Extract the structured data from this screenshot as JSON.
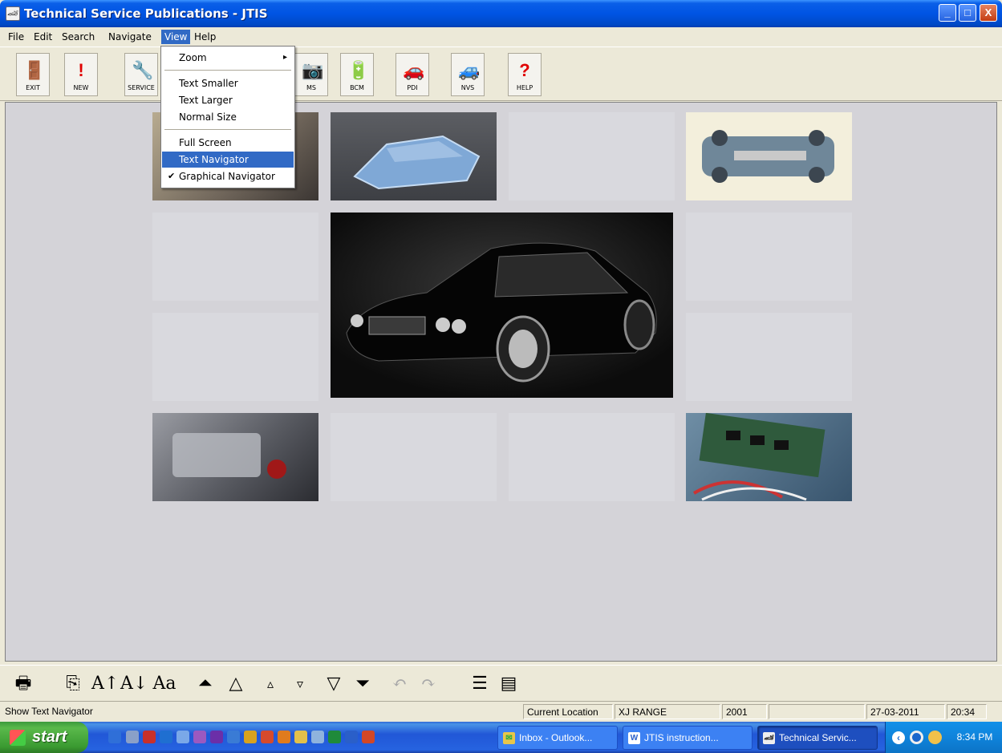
{
  "window": {
    "title": "Technical Service Publications - JTIS",
    "app_icon_glyph": "🏎",
    "minimize": "_",
    "maximize": "□",
    "close": "X"
  },
  "menu": {
    "items": [
      "File",
      "Edit",
      "Search",
      "Navigate",
      "View",
      "Help"
    ],
    "open_menu": "View"
  },
  "view_menu": {
    "items": [
      {
        "label": "Zoom",
        "submenu_arrow": "▸"
      },
      {
        "label": "Text Smaller"
      },
      {
        "label": "Text Larger"
      },
      {
        "label": "Normal Size"
      },
      {
        "label": "Full Screen"
      },
      {
        "label": "Text Navigator",
        "highlighted": true
      },
      {
        "label": "Graphical Navigator",
        "checked": true,
        "check": "✔"
      }
    ]
  },
  "toolbar": {
    "buttons": [
      {
        "label": "EXIT",
        "icon": "exit-door-icon",
        "glyph": "🚪"
      },
      {
        "label": "NEW",
        "icon": "exclamation-icon",
        "glyph": "!"
      },
      {
        "label": "SERVICE",
        "icon": "wrench-icon",
        "glyph": "🔧"
      },
      {
        "label": "MS",
        "icon": "camera-icon",
        "glyph": "📷"
      },
      {
        "label": "BCM",
        "icon": "battery-icon",
        "glyph": "🔋"
      },
      {
        "label": "PDI",
        "icon": "car-inspection-icon",
        "glyph": "🚗"
      },
      {
        "label": "NVS",
        "icon": "car-noise-icon",
        "glyph": "🚙"
      },
      {
        "label": "HELP",
        "icon": "question-icon",
        "glyph": "?"
      }
    ]
  },
  "navigator": {
    "images": [
      {
        "name": "car-front-image",
        "subject": "Jaguar front view",
        "color": "#8a7d6a"
      },
      {
        "name": "body-shell-image",
        "subject": "Body shell",
        "color": "#6f8fb0"
      },
      {
        "name": "chassis-image",
        "subject": "Chassis underbody",
        "color": "#c7ccd1"
      },
      {
        "name": "main-car-image",
        "subject": "Black Jaguar XJR",
        "color": "#1a1a1a"
      },
      {
        "name": "engine-bay-image",
        "subject": "Engine bay",
        "color": "#6d6e73"
      },
      {
        "name": "electronics-image",
        "subject": "Circuit boards and wiring",
        "color": "#4f6f88"
      }
    ]
  },
  "bottom_toolbar": {
    "buttons": [
      {
        "name": "print-icon",
        "glyph": "🖶"
      },
      {
        "name": "copy-icon",
        "glyph": "⎘"
      },
      {
        "name": "text-larger-icon",
        "glyph": "A↑"
      },
      {
        "name": "text-smaller-icon",
        "glyph": "A↓"
      },
      {
        "name": "normal-text-icon",
        "glyph": "Aa"
      },
      {
        "name": "first-page-icon",
        "glyph": "⏶"
      },
      {
        "name": "previous-page-icon",
        "glyph": "△"
      },
      {
        "name": "previous-icon",
        "glyph": "▵"
      },
      {
        "name": "next-icon",
        "glyph": "▿"
      },
      {
        "name": "next-page-icon",
        "glyph": "▽"
      },
      {
        "name": "last-page-icon",
        "glyph": "⏷"
      },
      {
        "name": "back-icon",
        "glyph": "↶"
      },
      {
        "name": "forward-icon",
        "glyph": "↷"
      },
      {
        "name": "list-view-icon",
        "glyph": "☰"
      },
      {
        "name": "document-view-icon",
        "glyph": "▤"
      }
    ]
  },
  "statusbar": {
    "message": "Show Text Navigator",
    "location_label": "Current Location",
    "location_value": "XJ RANGE",
    "year": "2001",
    "empty": "",
    "date": "27-03-2011",
    "time": "20:34"
  },
  "taskbar": {
    "start": "start",
    "tasks": [
      {
        "label": "Inbox - Outlook...",
        "icon": "outlook-icon",
        "glyph": "✉"
      },
      {
        "label": "JTIS instruction...",
        "icon": "word-icon",
        "glyph": "W"
      },
      {
        "label": "Technical Servic...",
        "icon": "jtis-icon",
        "glyph": "🏎",
        "active": true
      }
    ],
    "clock": "8:34 PM"
  }
}
